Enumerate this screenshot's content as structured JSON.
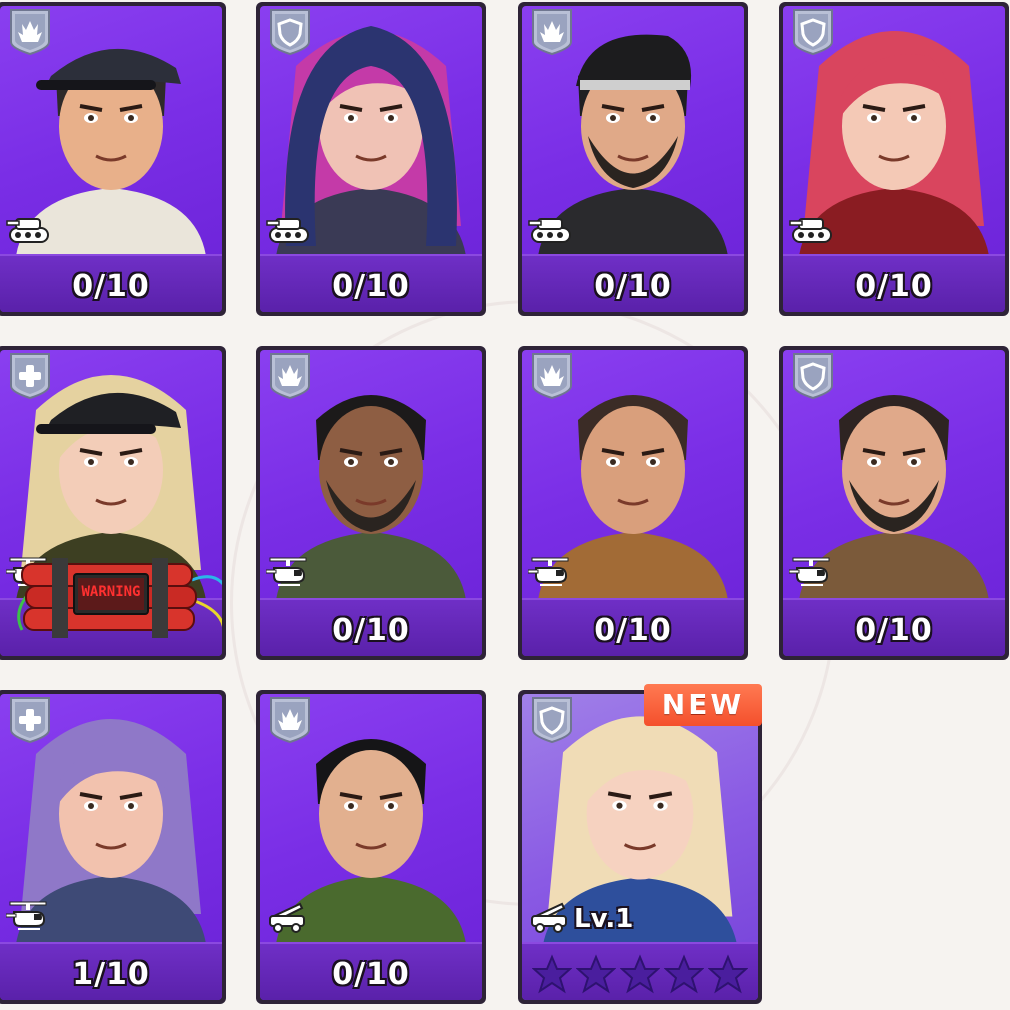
{
  "cards": [
    {
      "id": "c1",
      "class": "assault",
      "unit": "tank",
      "count": "0/10",
      "palette": {
        "skin": "#e8b08a",
        "hair": "#2e2a2a",
        "outfit": "#eae5da",
        "hat": "#2c2f3a"
      }
    },
    {
      "id": "c2",
      "class": "defense",
      "unit": "tank",
      "count": "0/10",
      "palette": {
        "skin": "#f0c2b5",
        "hair": "#c43aa8",
        "outfit": "#3a3a55",
        "hat": "#2f3050"
      }
    },
    {
      "id": "c3",
      "class": "assault",
      "unit": "tank",
      "count": "0/10",
      "palette": {
        "skin": "#e0a988",
        "hair": "#1f1f22",
        "outfit": "#2a2a2d",
        "hat": "#1c1c1e"
      }
    },
    {
      "id": "c4",
      "class": "defense",
      "unit": "tank",
      "count": "0/10",
      "palette": {
        "skin": "#f4c9b6",
        "hair": "#d9455e",
        "outfit": "#8a1c22",
        "hat": "#d9455e"
      }
    },
    {
      "id": "c5",
      "class": "support",
      "unit": "helicopter",
      "count": "",
      "palette": {
        "skin": "#f3cdb8",
        "hair": "#e5d2a0",
        "outfit": "#3d3f22",
        "hat": "#1f2024"
      },
      "item_label": "WARNING"
    },
    {
      "id": "c6",
      "class": "assault",
      "unit": "helicopter",
      "count": "0/10",
      "palette": {
        "skin": "#8e5e43",
        "hair": "#1c1a1a",
        "outfit": "#4b5a3a",
        "hat": "#1c1a1a"
      }
    },
    {
      "id": "c7",
      "class": "assault",
      "unit": "helicopter",
      "count": "0/10",
      "palette": {
        "skin": "#d99f7c",
        "hair": "#3b2c26",
        "outfit": "#a26b36",
        "hat": "#3b2c26"
      }
    },
    {
      "id": "c8",
      "class": "defense",
      "unit": "helicopter",
      "count": "0/10",
      "palette": {
        "skin": "#e0a98a",
        "hair": "#2e2422",
        "outfit": "#7b5a3a",
        "hat": "#2e2422"
      }
    },
    {
      "id": "c9",
      "class": "support",
      "unit": "helicopter",
      "count": "1/10",
      "palette": {
        "skin": "#f2c2ae",
        "hair": "#8f78c8",
        "outfit": "#3e4a76",
        "hat": "#8f78c8"
      }
    },
    {
      "id": "c10",
      "class": "assault",
      "unit": "artillery",
      "count": "0/10",
      "palette": {
        "skin": "#e2b08f",
        "hair": "#151517",
        "outfit": "#4a6a2e",
        "hat": "#151517"
      }
    },
    {
      "id": "c11",
      "class": "defense",
      "unit": "artillery",
      "count": "",
      "level": "Lv.1",
      "new_label": "NEW",
      "stars": 5,
      "stars_filled": 0,
      "palette": {
        "skin": "#f6d2c0",
        "hair": "#f0dcb6",
        "outfit": "#2e4f9c",
        "hat": "#f0dcb6"
      }
    }
  ],
  "colors": {
    "card_purple": "#7a2ee6",
    "frame": "#2e2337",
    "new_badge": "#f4502c",
    "badge_silver": "#c9cfe0"
  }
}
